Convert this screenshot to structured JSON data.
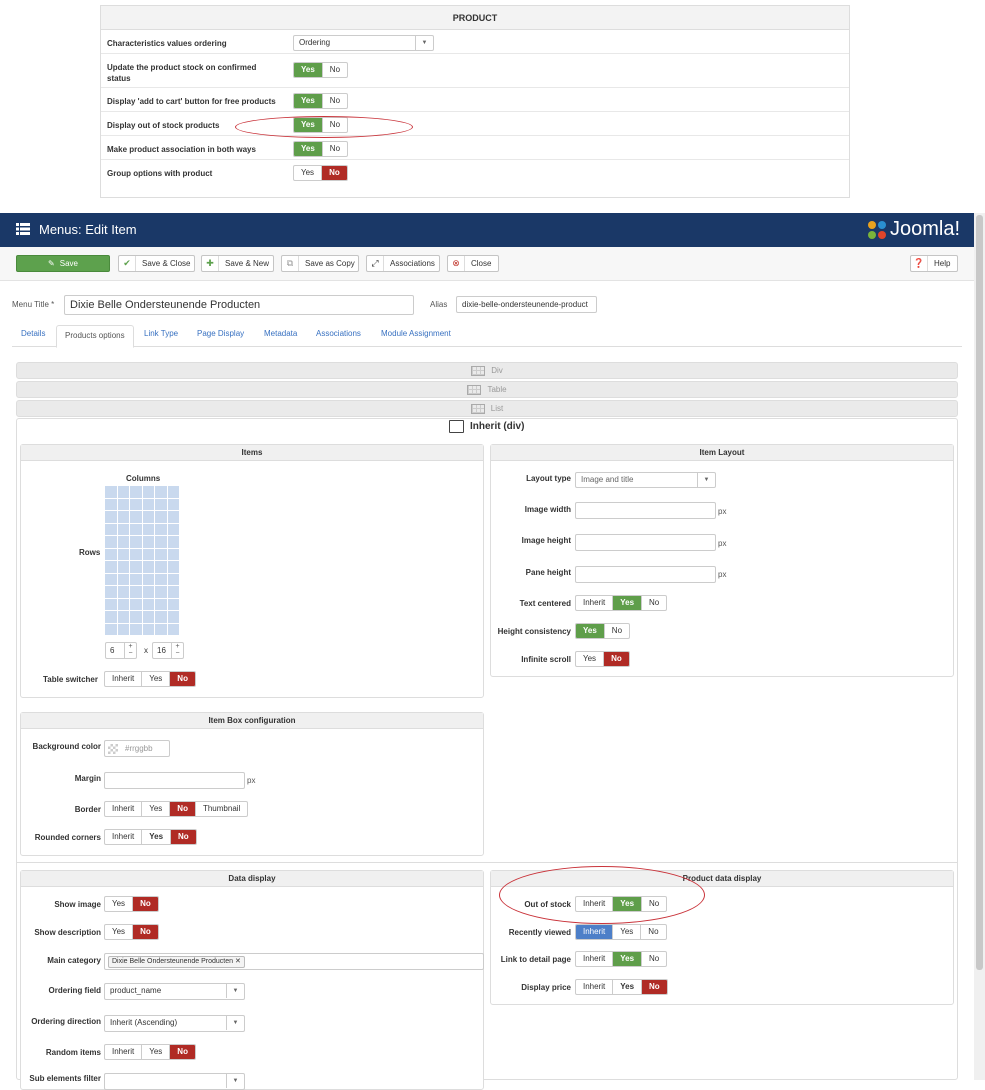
{
  "product_panel": {
    "title": "PRODUCT",
    "rows": [
      {
        "label": "Characteristics values ordering",
        "type": "select",
        "value": "Ordering"
      },
      {
        "label": "Update the product stock on confirmed status",
        "type": "toggle",
        "yes": "Yes",
        "no": "No",
        "active": "yes"
      },
      {
        "label": "Display 'add to cart' button for free products",
        "type": "toggle",
        "yes": "Yes",
        "no": "No",
        "active": "yes"
      },
      {
        "label": "Display out of stock products",
        "type": "toggle",
        "yes": "Yes",
        "no": "No",
        "active": "yes"
      },
      {
        "label": "Make product association in both ways",
        "type": "toggle",
        "yes": "Yes",
        "no": "No",
        "active": "yes"
      },
      {
        "label": "Group options with product",
        "type": "toggle",
        "yes": "Yes",
        "no": "No",
        "active": "no"
      }
    ]
  },
  "header": {
    "title": "Menus: Edit Item",
    "logo": "Joomla!",
    "menu_icon": "list-icon"
  },
  "toolbar": {
    "save": "Save",
    "save_close": "Save & Close",
    "save_new": "Save & New",
    "save_copy": "Save as Copy",
    "associations": "Associations",
    "close": "Close",
    "help": "Help"
  },
  "form": {
    "menu_title_label": "Menu Title *",
    "menu_title_value": "Dixie Belle Ondersteunende Producten",
    "alias_label": "Alias",
    "alias_value": "dixie-belle-ondersteunende-product"
  },
  "tabs": [
    "Details",
    "Products options",
    "Link Type",
    "Page Display",
    "Metadata",
    "Associations",
    "Module Assignment"
  ],
  "layout_bars": [
    "Div",
    "Table",
    "List"
  ],
  "layout_selected": "Inherit (div)",
  "items": {
    "title": "Items",
    "columns_label": "Columns",
    "rows_label": "Rows",
    "columns_value": "6",
    "x": "x",
    "rows_value": "16",
    "table_switcher_label": "Table switcher",
    "table_switcher": {
      "options": [
        "Inherit",
        "Yes",
        "No"
      ],
      "active": "No"
    }
  },
  "item_layout": {
    "title": "Item Layout",
    "layout_type_label": "Layout type",
    "layout_type_value": "Image and title",
    "image_width_label": "Image width",
    "image_height_label": "Image height",
    "pane_height_label": "Pane height",
    "unit": "px",
    "text_centered_label": "Text centered",
    "height_consistency_label": "Height consistency",
    "infinite_scroll_label": "Infinite scroll",
    "inherit": "Inherit",
    "yes": "Yes",
    "no": "No"
  },
  "item_box": {
    "title": "Item Box configuration",
    "background_label": "Background color",
    "background_placeholder": "#rrggbb",
    "margin_label": "Margin",
    "unit": "px",
    "border_label": "Border",
    "border_opts": [
      "Inherit",
      "Yes",
      "No",
      "Thumbnail"
    ],
    "rounded_label": "Rounded corners"
  },
  "data_display": {
    "title": "Data display",
    "show_image_label": "Show image",
    "show_description_label": "Show description",
    "main_category_label": "Main category",
    "main_category_tag": "Dixie Belle Ondersteunende Producten",
    "ordering_field_label": "Ordering field",
    "ordering_field_value": "product_name",
    "ordering_direction_label": "Ordering direction",
    "ordering_direction_value": "Inherit (Ascending)",
    "random_items_label": "Random items",
    "sub_elements_label": "Sub elements filter"
  },
  "product_data": {
    "title": "Product data display",
    "out_of_stock_label": "Out of stock",
    "recently_viewed_label": "Recently viewed",
    "link_detail_label": "Link to detail page",
    "display_price_label": "Display price"
  },
  "colors": {
    "brand_bar": "#1a3867",
    "green": "#5f9e4a",
    "red": "#b02b25",
    "blue": "#4d7fc8",
    "annotation": "#c9333a"
  }
}
